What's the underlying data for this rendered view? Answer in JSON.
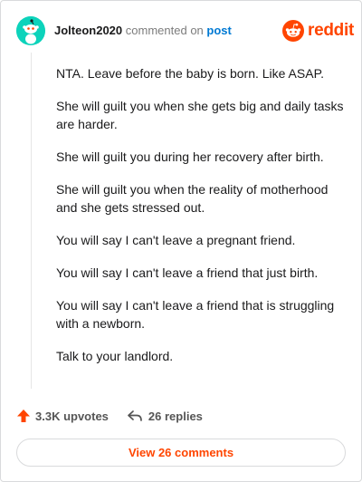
{
  "header": {
    "username": "Jolteon2020",
    "action": "commented on",
    "link_text": "post",
    "logo_text": "reddit"
  },
  "comment": {
    "paragraphs": [
      "NTA. Leave before the baby is born. Like ASAP.",
      "She will guilt you when she gets big and daily tasks are harder.",
      "She will guilt you during her recovery after birth.",
      "She will guilt you when the reality of motherhood and she gets stressed out.",
      "You will say I can't leave a pregnant friend.",
      "You will say I can't leave a friend that just birth.",
      "You will say I can't leave a friend that is struggling with a newborn.",
      "Talk to your landlord."
    ]
  },
  "footer": {
    "upvotes": "3.3K upvotes",
    "replies": "26 replies",
    "view_comments": "View 26 comments"
  },
  "colors": {
    "brand": "#ff4500",
    "link": "#0079d3",
    "avatar": "#0dd3bb"
  },
  "icons": {
    "avatar": "snoo-avatar-icon",
    "logo": "reddit-snoo-icon",
    "upvote": "upvote-arrow-icon",
    "reply": "reply-arrow-icon"
  }
}
